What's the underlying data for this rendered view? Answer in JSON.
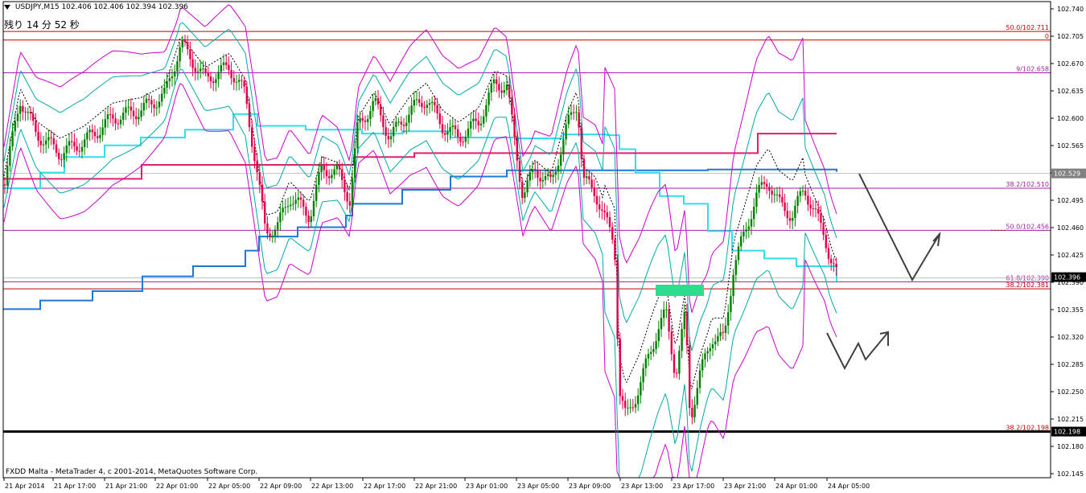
{
  "header": {
    "symbol_label": "USDJPY,M15",
    "ohlc": "102.406 102.406 102.394 102.396"
  },
  "timer": "残り 14 分 52 秒",
  "copyright": "FXDD Malta - MetaTrader 4, c 2001-2014, MetaQuotes Software Corp.",
  "chart_data": {
    "type": "candlestick",
    "symbol": "USDJPY",
    "timeframe": "M15",
    "ylim": [
      102.15,
      102.74
    ],
    "y_ticks": [
      "102.740",
      "102.705",
      "102.670",
      "102.635",
      "102.600",
      "102.565",
      "102.530",
      "102.495",
      "102.460",
      "102.425",
      "102.390",
      "102.355",
      "102.320",
      "102.285",
      "102.250",
      "102.215",
      "102.180",
      "102.145"
    ],
    "x_ticks": [
      "21 Apr 2014",
      "21 Apr 17:00",
      "21 Apr 21:00",
      "22 Apr 01:00",
      "22 Apr 05:00",
      "22 Apr 09:00",
      "22 Apr 13:00",
      "22 Apr 17:00",
      "22 Apr 21:00",
      "23 Apr 01:00",
      "23 Apr 05:00",
      "23 Apr 09:00",
      "23 Apr 13:00",
      "23 Apr 17:00",
      "23 Apr 21:00",
      "24 Apr 01:00",
      "24 Apr 05:00"
    ],
    "price_markers": [
      {
        "price": 102.529,
        "label": "102.529",
        "color": "#808080"
      },
      {
        "price": 102.396,
        "label": "102.396",
        "color": "#000000"
      },
      {
        "price": 102.198,
        "label": "102.198",
        "color": "#000000"
      }
    ],
    "fibo_levels": [
      {
        "price": 102.711,
        "label": "50.0/102.711",
        "color": "#c00000"
      },
      {
        "price": 102.7,
        "label": "0",
        "color": "#c00000"
      },
      {
        "price": 102.658,
        "label": "9/102.658",
        "color": "#a020a0"
      },
      {
        "price": 102.51,
        "label": "38.2/102.510",
        "color": "#a020a0"
      },
      {
        "price": 102.456,
        "label": "50.0/102.456",
        "color": "#a020a0"
      },
      {
        "price": 102.39,
        "label": "61.8/102.390",
        "color": "#a020a0"
      },
      {
        "price": 102.381,
        "label": "38.2/102.381",
        "color": "#c00000"
      },
      {
        "price": 102.198,
        "label": "38.2/102.198",
        "color": "#c00000"
      }
    ],
    "colors": {
      "bull": "#008000",
      "bear": "#e0004a",
      "bb_outer": "#cc00cc",
      "bb_inner": "#00aaaa",
      "ma_dotted": "#000000",
      "step_blue": "#1e78d8",
      "step_cyan": "#33ddee",
      "step_pink": "#e0206a",
      "zone": "#2ddc8c",
      "drawing": "#404040"
    }
  }
}
